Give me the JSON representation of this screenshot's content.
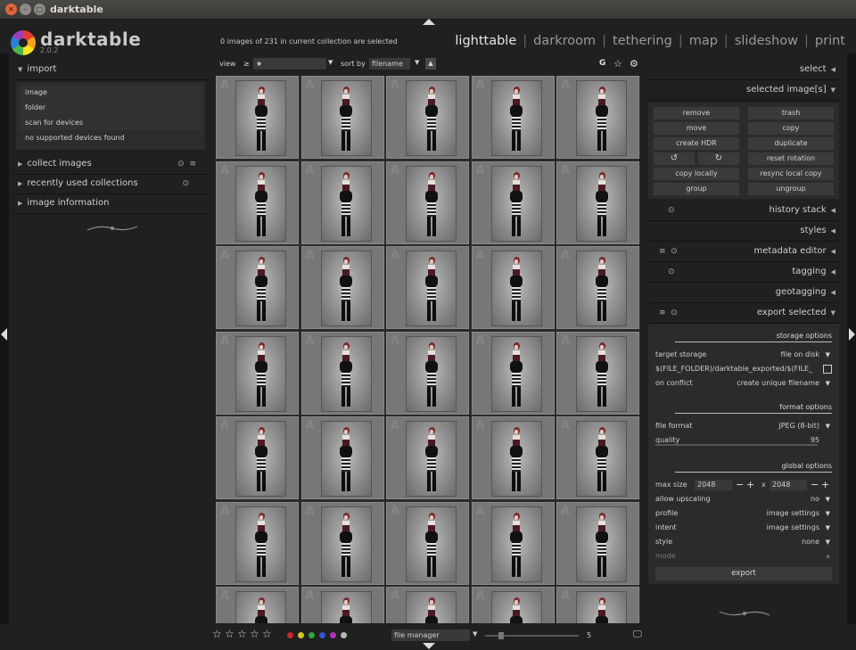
{
  "window": {
    "title": "darktable"
  },
  "app": {
    "name": "darktable",
    "version": "2.0.2"
  },
  "header": {
    "selection_info": "0 images of 231 in current collection are selected",
    "views": [
      "lighttable",
      "darkroom",
      "tethering",
      "map",
      "slideshow",
      "print"
    ],
    "active_view": "lighttable"
  },
  "left_panel": {
    "import": {
      "title": "import",
      "items": [
        "image",
        "folder",
        "scan for devices",
        "no supported devices found"
      ]
    },
    "modules": [
      "collect images",
      "recently used collections",
      "image information"
    ]
  },
  "toolbar": {
    "view_label": "view",
    "rating_op": "≥",
    "rating_value": "★",
    "sort_label": "sort by",
    "sort_value": "filename",
    "sort_direction": "▲",
    "grouping_label": "G"
  },
  "thumbnails": {
    "columns": 5,
    "visible_rows": 7,
    "count": 35,
    "watermark": "A"
  },
  "bottom_bar": {
    "stars": [
      "☆",
      "☆",
      "☆",
      "☆",
      "☆"
    ],
    "color_labels": [
      "#c9272e",
      "#d4c722",
      "#2fa83a",
      "#3553d6",
      "#b032b6",
      "#b8b8b8"
    ],
    "layout": "file manager",
    "zoom": "5"
  },
  "right_panel": {
    "select_title": "select",
    "selected_title": "selected image[s]",
    "selected_buttons": {
      "remove": "remove",
      "trash": "trash",
      "move": "move",
      "copy": "copy",
      "create_hdr": "create HDR",
      "duplicate": "duplicate",
      "rotate_ccw": "↺",
      "rotate_cw": "↻",
      "reset_rotation": "reset rotation",
      "copy_locally": "copy locally",
      "resync": "resync local copy",
      "group": "group",
      "ungroup": "ungroup"
    },
    "modules": [
      "history stack",
      "styles",
      "metadata editor",
      "tagging",
      "geotagging"
    ],
    "export": {
      "title": "export selected",
      "storage_options": "storage options",
      "target_storage_label": "target storage",
      "target_storage_value": "file on disk",
      "path": "$(FILE_FOLDER)/darktable_exported/$(FILE_",
      "on_conflict_label": "on conflict",
      "on_conflict_value": "create unique filename",
      "format_options": "format options",
      "file_format_label": "file format",
      "file_format_value": "JPEG (8-bit)",
      "quality_label": "quality",
      "quality_value": "95",
      "global_options": "global options",
      "max_size_label": "max size",
      "max_w": "2048",
      "max_x": "x",
      "max_h": "2048",
      "upscaling_label": "allow upscaling",
      "upscaling_value": "no",
      "profile_label": "profile",
      "profile_value": "image settings",
      "intent_label": "intent",
      "intent_value": "image settings",
      "style_label": "style",
      "style_value": "none",
      "mode_label": "mode",
      "export_button": "export"
    }
  }
}
